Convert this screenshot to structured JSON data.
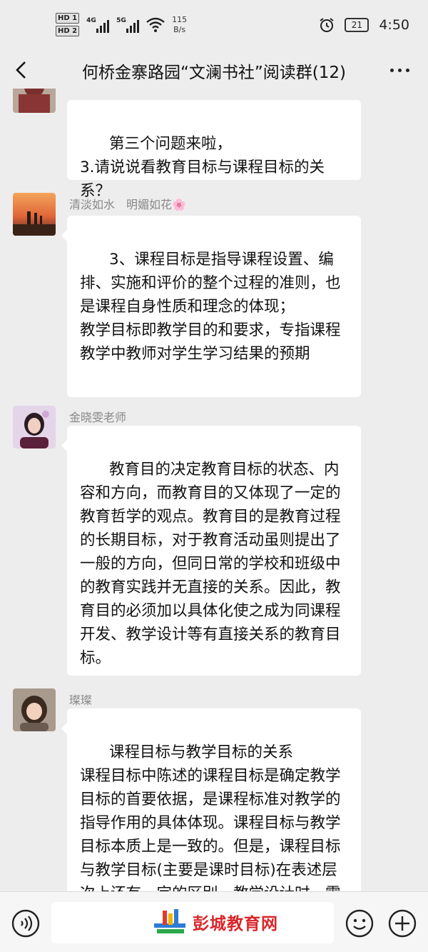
{
  "status_bar": {
    "hd1": "HD 1",
    "hd2": "HD 2",
    "net1": "4G",
    "net2": "5G",
    "speed_value": "115",
    "speed_unit": "B/s",
    "battery": "21",
    "time": "4:50"
  },
  "header": {
    "title": "何桥金寨路园“文澜书社”阅读群(12)",
    "back_icon": "chevron-left-icon",
    "more_icon": "more-dots-icon"
  },
  "messages": [
    {
      "sender": "",
      "text": "第三个问题来啦，\n3.请说说看教育目标与课程目标的关系？"
    },
    {
      "sender": "清淡如水　明媚如花🌸",
      "text": "3、课程目标是指导课程设置、编排、实施和评价的整个过程的准则，也是课程自身性质和理念的体现；\n教学目标即教学目的和要求，专指课程教学中教师对学生学习结果的预期"
    },
    {
      "sender": "金晓雯老师",
      "text": "教育目的决定教育目标的状态、内容和方向，而教育目的又体现了一定的教育哲学的观点。教育目的是教育过程的长期目标，对于教育活动虽则提出了一般的方向，但同日常的学校和班级中的教育实践并无直接的关系。因此，教育目的必须加以具体化使之成为同课程开发、教学设计等有直接关系的教育目标。"
    },
    {
      "sender": "璨璨",
      "text": "课程目标与教学目标的关系\n课程目标中陈述的课程目标是确定教学目标的首要依据，是课程标准对教学的指导作用的具体体现。课程目标与教学目标本质上是一致的。但是，课程目标与教学目标(主要是课时目标)在表述层次上还有一定的区别，教学设计时，需要"
    }
  ],
  "bottom_bar": {
    "voice_icon": "voice-icon",
    "watermark": "彭城教育网",
    "emoji_icon": "emoji-icon",
    "plus_icon": "plus-icon"
  }
}
